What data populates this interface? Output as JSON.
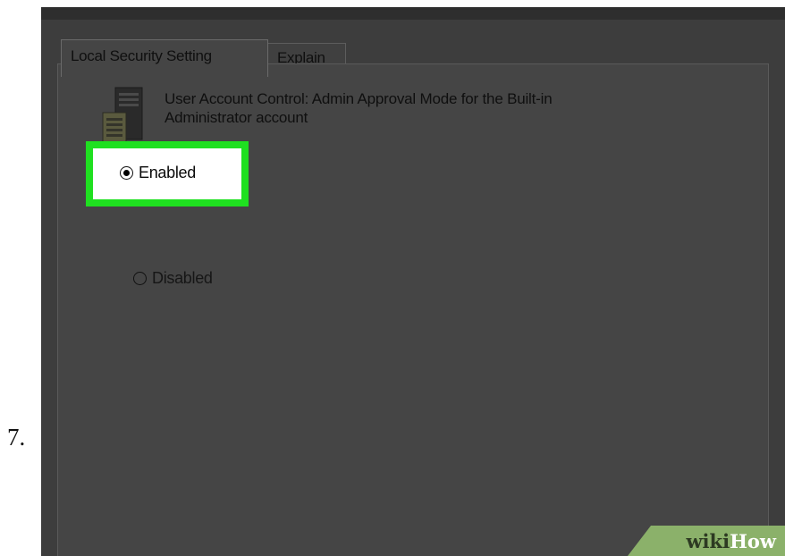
{
  "step": {
    "number": "7."
  },
  "tabs": [
    {
      "label": "Local Security Setting",
      "active": true
    },
    {
      "label": "Explain",
      "active": false
    }
  ],
  "policy": {
    "icon": "server-computer-icon",
    "description_line1": "User Account Control: Admin Approval Mode for the Built-in",
    "description_line2": "Administrator account"
  },
  "options": [
    {
      "label": "Enabled",
      "selected": true
    },
    {
      "label": "Disabled",
      "selected": false
    }
  ],
  "highlight": {
    "target": "Enabled",
    "color": "#1fe020"
  },
  "watermark": {
    "part1": "wiki",
    "part2": "How",
    "color": "#8bb16a"
  }
}
